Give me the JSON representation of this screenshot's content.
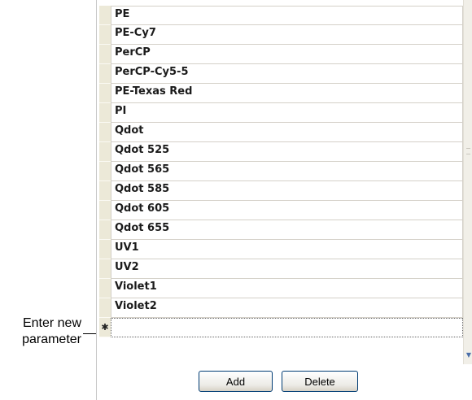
{
  "callout": {
    "line1": "Enter new",
    "line2": "parameter"
  },
  "parameters": [
    "PE",
    "PE-Cy7",
    "PerCP",
    "PerCP-Cy5-5",
    "PE-Texas Red",
    "PI",
    "Qdot",
    "Qdot 525",
    "Qdot 565",
    "Qdot 585",
    "Qdot 605",
    "Qdot 655",
    "UV1",
    "UV2",
    "Violet1",
    "Violet2"
  ],
  "new_row": {
    "value": "",
    "marker": "✱"
  },
  "buttons": {
    "add": "Add",
    "delete": "Delete"
  },
  "icons": {
    "new_row_marker": "pencil-star-icon",
    "scroll_down": "chevron-down-icon",
    "scroll_grip": "grip-icon"
  }
}
